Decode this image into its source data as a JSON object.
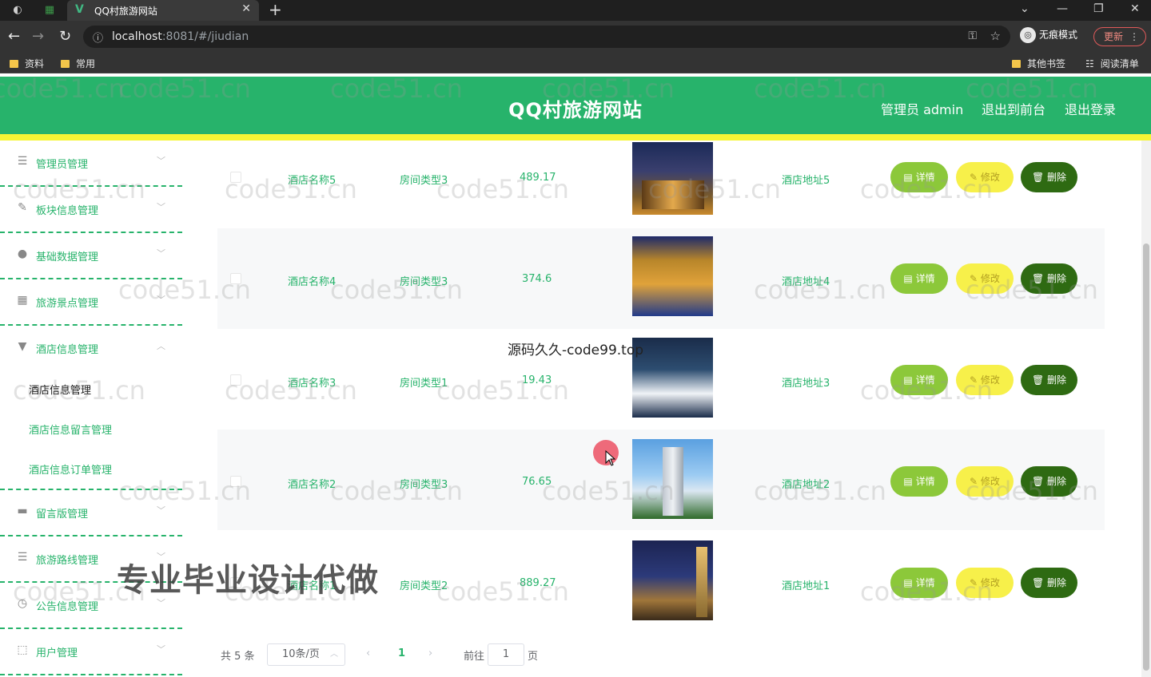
{
  "browser": {
    "tab_title": "QQ村旅游网站",
    "url_host": "localhost",
    "url_path": ":8081/#/jiudian",
    "incognito_label": "无痕模式",
    "update_label": "更新",
    "bookmarks": [
      "资料",
      "常用"
    ],
    "bookmarks_right": [
      "其他书签",
      "阅读清单"
    ]
  },
  "header": {
    "site_title": "QQ村旅游网站",
    "admin_label": "管理员 admin",
    "to_front_label": "退出到前台",
    "logout_label": "退出登录",
    "accent_color": "#27b36b",
    "stripe_color": "#f5f535"
  },
  "sidebar": {
    "items": [
      {
        "label": "管理员管理",
        "icon": "list-icon"
      },
      {
        "label": "板块信息管理",
        "icon": "pen-icon"
      },
      {
        "label": "基础数据管理",
        "icon": "bulb-icon"
      },
      {
        "label": "旅游景点管理",
        "icon": "grid-icon"
      },
      {
        "label": "酒店信息管理",
        "icon": "sign-icon"
      },
      {
        "label": "留言版管理",
        "icon": "chat-icon"
      },
      {
        "label": "旅游路线管理",
        "icon": "sliders-icon"
      },
      {
        "label": "公告信息管理",
        "icon": "clock-icon"
      },
      {
        "label": "用户管理",
        "icon": "frame-icon"
      }
    ],
    "submenu": [
      {
        "label": "酒店信息管理",
        "active": true
      },
      {
        "label": "酒店信息留言管理",
        "active": false
      },
      {
        "label": "酒店信息订单管理",
        "active": false
      }
    ]
  },
  "table": {
    "rows": [
      {
        "name": "酒店名称5",
        "type": "房间类型3",
        "price": "489.17",
        "address": "酒店地址5"
      },
      {
        "name": "酒店名称4",
        "type": "房间类型3",
        "price": "374.6",
        "address": "酒店地址4"
      },
      {
        "name": "酒店名称3",
        "type": "房间类型1",
        "price": "19.43",
        "address": "酒店地址3"
      },
      {
        "name": "酒店名称2",
        "type": "房间类型3",
        "price": "76.65",
        "address": "酒店地址2"
      },
      {
        "name": "酒店名称1",
        "type": "房间类型2",
        "price": "889.27",
        "address": "酒店地址1"
      }
    ],
    "detail_label": "详情",
    "edit_label": "修改",
    "delete_label": "删除"
  },
  "pagination": {
    "total_label": "共 5 条",
    "page_size_label": "10条/页",
    "current_page": "1",
    "goto_label": "前往",
    "goto_value": "1",
    "page_suffix": "页"
  },
  "overlays": {
    "small_text": "源码久久-code99.top",
    "big_text": "专业毕业设计代做",
    "watermark": "code51.cn"
  }
}
